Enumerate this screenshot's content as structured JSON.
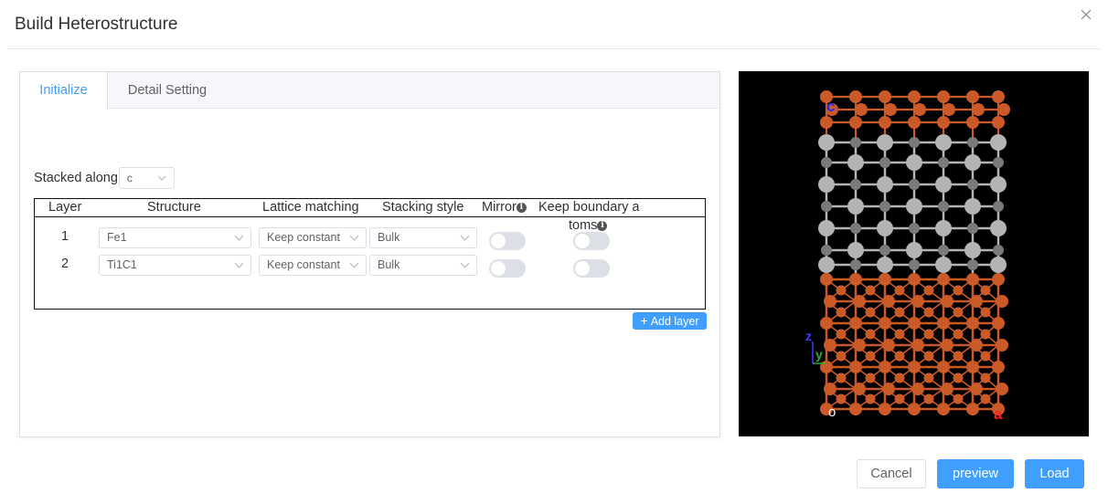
{
  "dialog": {
    "title": "Build Heterostructure"
  },
  "tabs": [
    {
      "label": "Initialize",
      "active": true
    },
    {
      "label": "Detail Setting",
      "active": false
    }
  ],
  "stacked_along": {
    "label": "Stacked along",
    "value": "c"
  },
  "table": {
    "headers": {
      "layer": "Layer",
      "structure": "Structure",
      "lattice": "Lattice matching",
      "stacking": "Stacking style",
      "mirror": "Mirror",
      "keep_line1": "Keep boundary a",
      "keep_line2": "toms"
    },
    "rows": [
      {
        "layer": "1",
        "structure": "Fe1",
        "lattice": "Keep constant",
        "stacking": "Bulk",
        "mirror": false,
        "keep_boundary": false
      },
      {
        "layer": "2",
        "structure": "Ti1C1",
        "lattice": "Keep constant",
        "stacking": "Bulk",
        "mirror": false,
        "keep_boundary": false
      }
    ],
    "info_glyph": "i"
  },
  "add_layer": {
    "label": "Add layer",
    "icon": "plus-icon"
  },
  "viewer": {
    "axis_labels": {
      "c": "c",
      "a": "a",
      "z": "z",
      "y": "y",
      "o": "o"
    },
    "colors": {
      "fe_atom": "#cc5a28",
      "ti_atom": "#b4b4b4",
      "c_atom": "#7a7a7a",
      "background": "#000000"
    }
  },
  "footer": {
    "cancel": "Cancel",
    "preview": "preview",
    "load": "Load"
  },
  "colors": {
    "primary": "#409eff",
    "border": "#dcdfe6",
    "text": "#303133"
  }
}
